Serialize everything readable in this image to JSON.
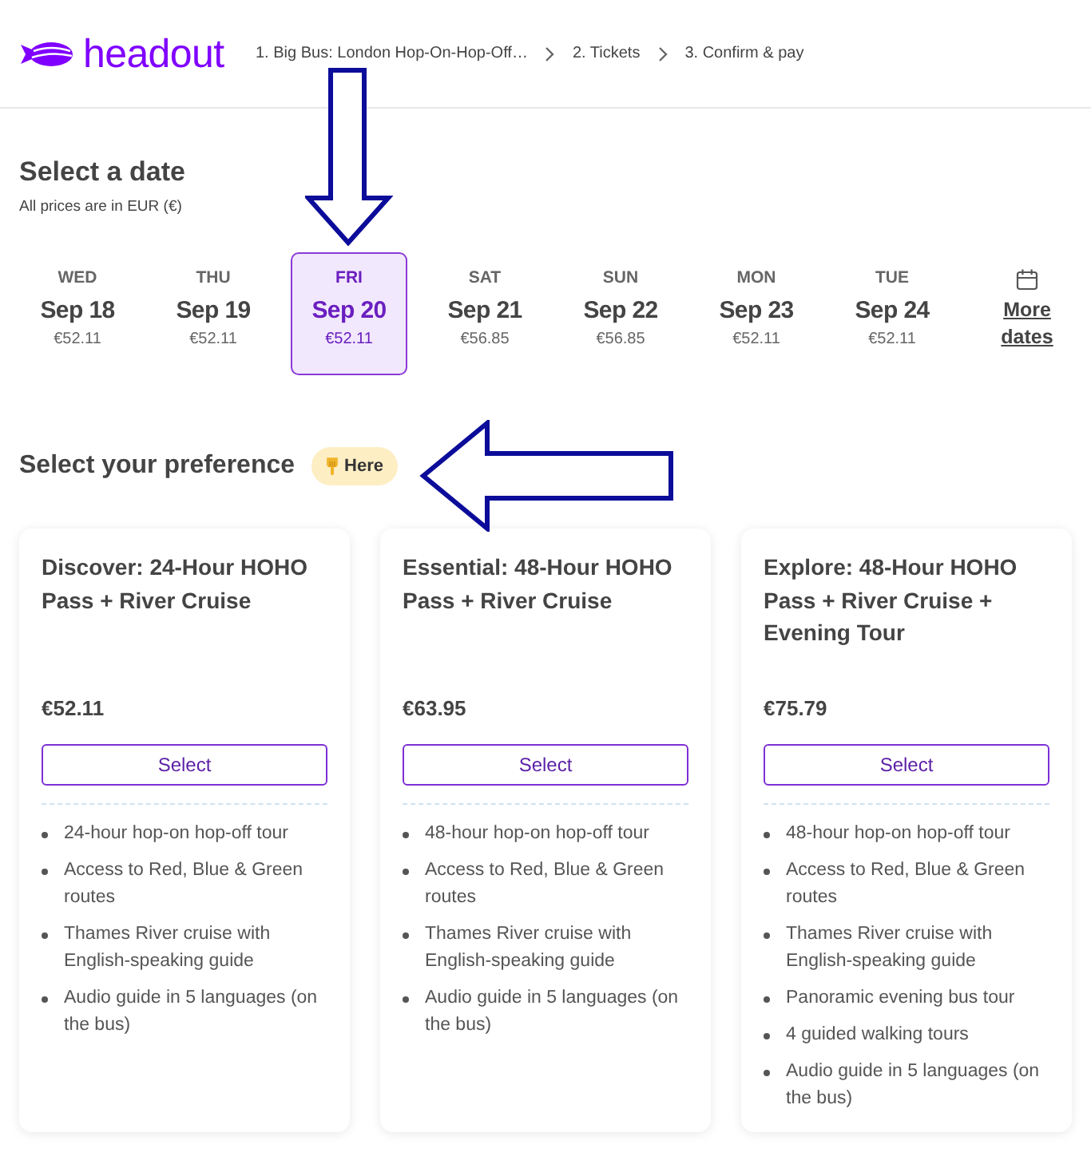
{
  "header": {
    "logo": "headout",
    "steps": [
      "1. Big Bus: London Hop-On-Hop-Off…",
      "2. Tickets",
      "3. Confirm & pay"
    ]
  },
  "date_section": {
    "title": "Select a date",
    "subtitle": "All prices are in EUR (€)",
    "dates": [
      {
        "day": "WED",
        "date": "Sep 18",
        "price": "€52.11",
        "selected": false
      },
      {
        "day": "THU",
        "date": "Sep 19",
        "price": "€52.11",
        "selected": false
      },
      {
        "day": "FRI",
        "date": "Sep 20",
        "price": "€52.11",
        "selected": true
      },
      {
        "day": "SAT",
        "date": "Sep 21",
        "price": "€56.85",
        "selected": false
      },
      {
        "day": "SUN",
        "date": "Sep 22",
        "price": "€56.85",
        "selected": false
      },
      {
        "day": "MON",
        "date": "Sep 23",
        "price": "€52.11",
        "selected": false
      },
      {
        "day": "TUE",
        "date": "Sep 24",
        "price": "€52.11",
        "selected": false
      }
    ],
    "more_dates": "More dates"
  },
  "preference_section": {
    "title": "Select your preference",
    "badge": "Here",
    "options": [
      {
        "title": "Discover: 24-Hour HOHO Pass + River Cruise",
        "price": "€52.11",
        "button": "Select",
        "features": [
          "24-hour hop-on hop-off tour",
          "Access to Red, Blue & Green routes",
          "Thames River cruise with English-speaking guide",
          "Audio guide in 5 languages (on the bus)"
        ]
      },
      {
        "title": "Essential: 48-Hour HOHO Pass + River Cruise",
        "price": "€63.95",
        "button": "Select",
        "features": [
          "48-hour hop-on hop-off tour",
          "Access to Red, Blue & Green routes",
          "Thames River cruise with English-speaking guide",
          "Audio guide in 5 languages (on the bus)"
        ]
      },
      {
        "title": "Explore: 48-Hour HOHO Pass + River Cruise + Evening Tour",
        "price": "€75.79",
        "button": "Select",
        "features": [
          "48-hour hop-on hop-off tour",
          "Access to Red, Blue & Green routes",
          "Thames River cruise with English-speaking guide",
          "Panoramic evening bus tour",
          "4 guided walking tours",
          "Audio guide in 5 languages (on the bus)"
        ]
      }
    ]
  }
}
